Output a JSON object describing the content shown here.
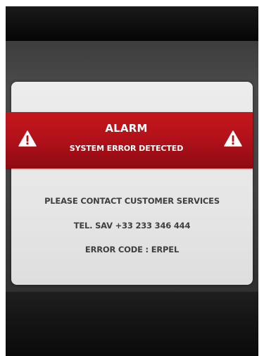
{
  "alarm": {
    "title": "ALARM",
    "subtitle": "SYSTEM ERROR DETECTED",
    "icon": "warning-triangle-icon",
    "banner_color": "#b3121a"
  },
  "message": {
    "contact": "PLEASE CONTACT CUSTOMER SERVICES",
    "phone": "TEL. SAV +33 233 346 444",
    "error_code": "ERROR CODE : ERPEL"
  }
}
